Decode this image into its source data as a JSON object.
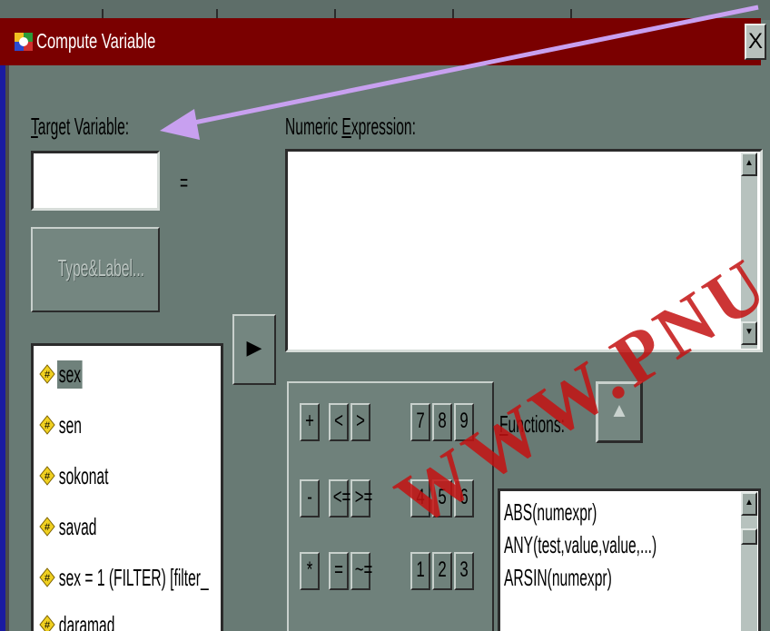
{
  "window": {
    "title": "Compute Variable",
    "close_label": "X"
  },
  "target": {
    "label_first": "T",
    "label_rest": "arget Variable:",
    "value": "",
    "equals": "="
  },
  "expression": {
    "label_first": "Numeric ",
    "label_u": "E",
    "label_rest": "xpression:",
    "value": ""
  },
  "type_label_button": "Type&Label...",
  "move_button": "▶",
  "variables": [
    {
      "name": "sex",
      "selected": true
    },
    {
      "name": "sen",
      "selected": false
    },
    {
      "name": "sokonat",
      "selected": false
    },
    {
      "name": "savad",
      "selected": false
    },
    {
      "name": "sex = 1 (FILTER) [filter_",
      "selected": false
    },
    {
      "name": "daramad",
      "selected": false
    }
  ],
  "keypad": {
    "row1": [
      "+",
      "<",
      ">",
      "7",
      "8",
      "9"
    ],
    "row2": [
      "-",
      "<=",
      ">=",
      "4",
      "5",
      "6"
    ],
    "row3": [
      "*",
      "=",
      "~=",
      "1",
      "2",
      "3"
    ]
  },
  "functions": {
    "label_u": "F",
    "label_rest": "unctions:",
    "up_button": "▲",
    "items": [
      "ABS(numexpr)",
      "ANY(test,value,value,...)",
      "ARSIN(numexpr)"
    ]
  },
  "watermark": "WWW.PNU",
  "colors": {
    "titlebar": "#7a0000",
    "dialog": "#687a74",
    "slide_background": "#1a1aa0",
    "annotation_arrow": "#c8a0f0",
    "watermark": "#c41212"
  }
}
